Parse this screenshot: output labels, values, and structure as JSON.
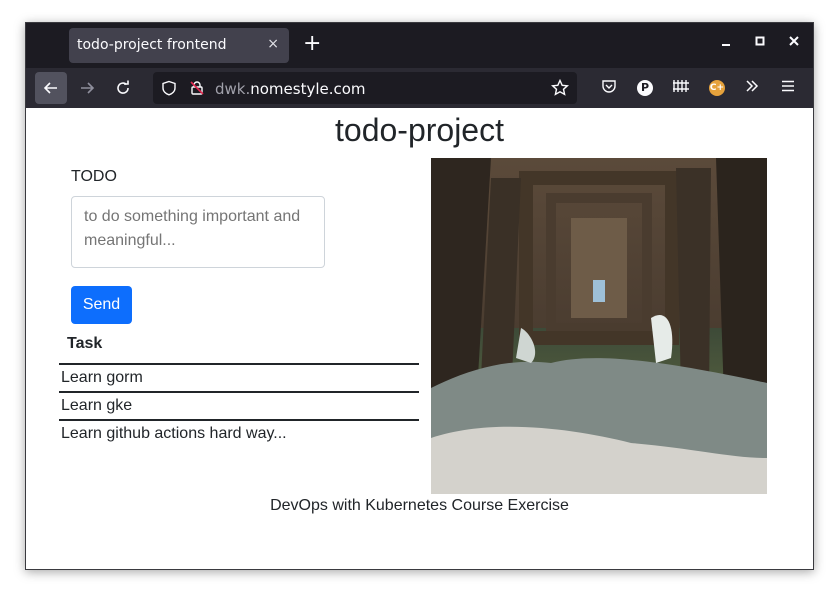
{
  "browser": {
    "tab_title": "todo-project frontend",
    "tab_close": "×",
    "new_tab": "+",
    "window_controls": {
      "minimize": "–",
      "maximize": "□",
      "close": "✕"
    },
    "url_domain_prefix": "dwk.",
    "url_domain_main": "nomestyle.com"
  },
  "page": {
    "title": "todo-project",
    "todo_label": "TODO",
    "textarea_placeholder": "to do something important and meaningful...",
    "send_label": "Send",
    "task_header": "Task",
    "tasks": [
      "Learn gorm",
      "Learn gke",
      "Learn github actions hard way..."
    ],
    "footer": "DevOps with Kubernetes Course Exercise"
  },
  "icons": [
    "back-arrow-icon",
    "forward-arrow-icon",
    "reload-icon",
    "shield-icon",
    "lock-icon",
    "star-icon",
    "pocket-icon",
    "extension-p-icon",
    "library-icon",
    "extension-c-icon",
    "overflow-icon",
    "menu-icon"
  ],
  "colors": {
    "accent": "#0d6efd",
    "tabbar": "#1c1b22",
    "toolbar": "#2b2a33"
  }
}
